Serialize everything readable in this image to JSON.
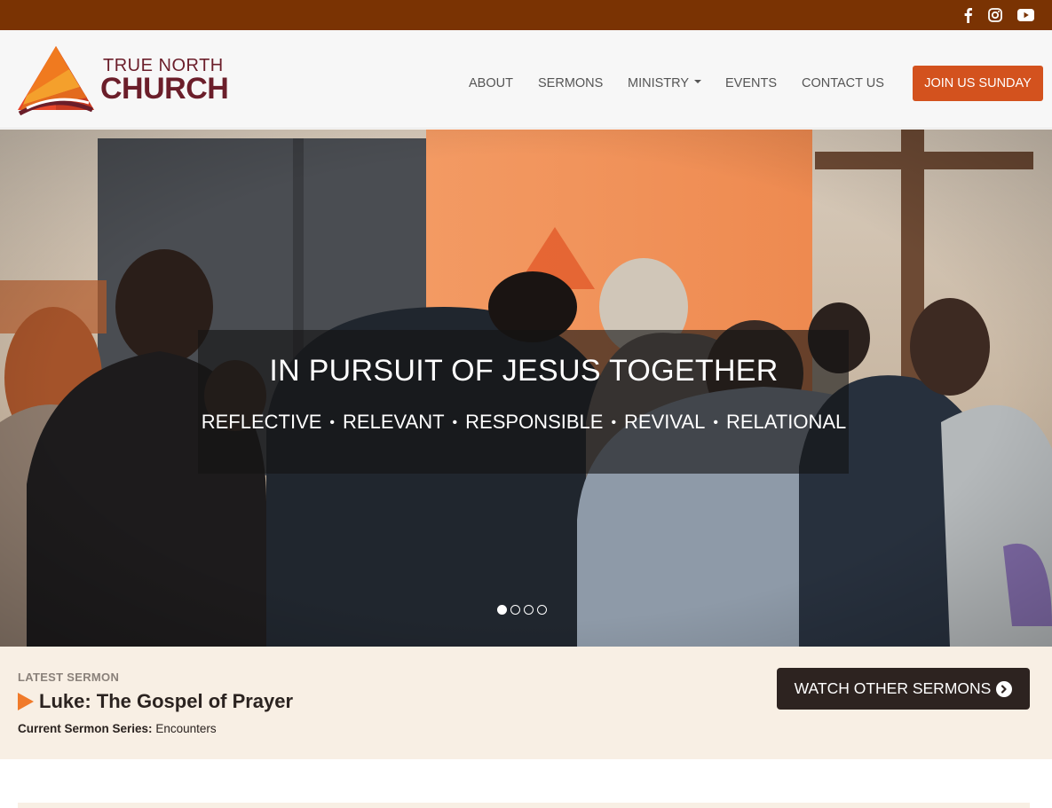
{
  "colors": {
    "topbar": "#7a3303",
    "accent": "#d3521e",
    "brand": "#6b1e2a",
    "dark_button": "#2d2320",
    "sermon_band": "#f8efe4"
  },
  "social": [
    {
      "icon": "facebook-icon"
    },
    {
      "icon": "instagram-icon"
    },
    {
      "icon": "youtube-icon"
    }
  ],
  "logo": {
    "line1": "TRUE NORTH",
    "line2": "CHURCH"
  },
  "nav": {
    "items": [
      "ABOUT",
      "SERMONS",
      "MINISTRY",
      "EVENTS",
      "CONTACT US"
    ],
    "cta": "JOIN US SUNDAY"
  },
  "hero": {
    "title": "IN PURSUIT OF JESUS TOGETHER",
    "values": [
      "REFLECTIVE",
      "RELEVANT",
      "RESPONSIBLE",
      "REVIVAL",
      "RELATIONAL"
    ],
    "separator": "•",
    "slide_count": 4,
    "active_slide": 1
  },
  "sermon": {
    "kicker": "LATEST SERMON",
    "title": "Luke: The Gospel of Prayer",
    "series_label": "Current Sermon Series:",
    "series_value": "Encounters",
    "watch_label": "WATCH OTHER SERMONS"
  }
}
